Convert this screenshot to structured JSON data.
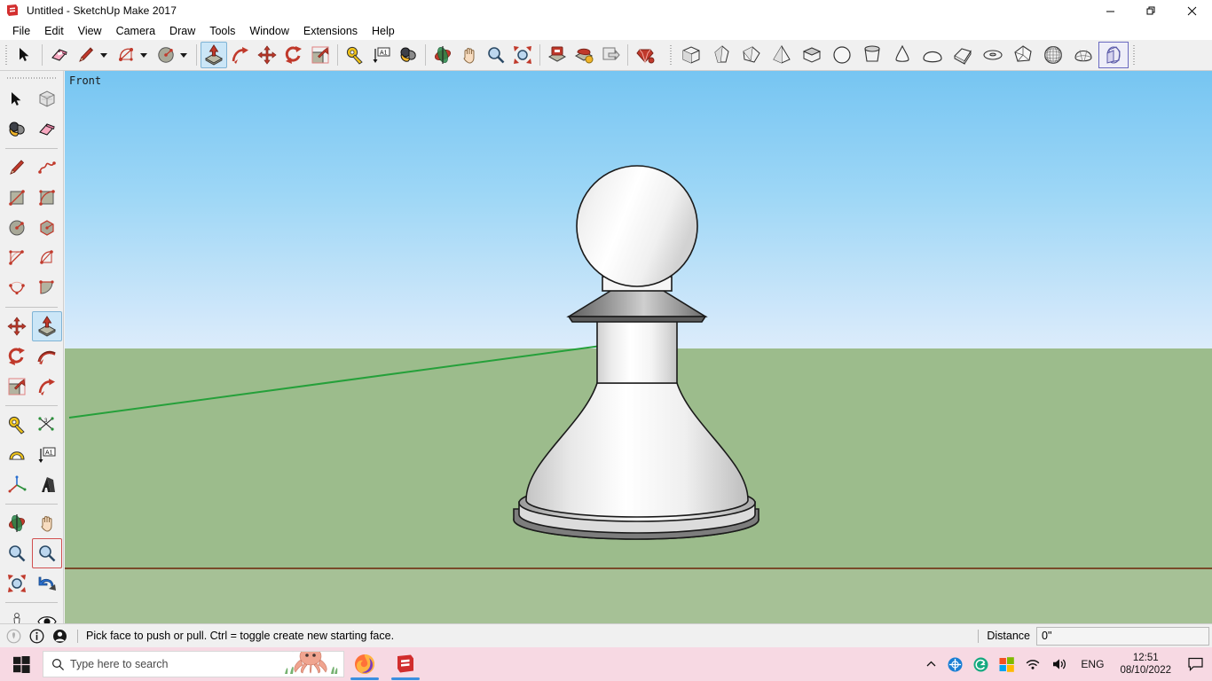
{
  "window": {
    "title": "Untitled - SketchUp Make 2017",
    "app_icon": "sketchup-logo-icon",
    "minimize": "—",
    "restore": "❐",
    "close": "✕"
  },
  "menubar": {
    "items": [
      {
        "label": "File"
      },
      {
        "label": "Edit"
      },
      {
        "label": "View"
      },
      {
        "label": "Camera"
      },
      {
        "label": "Draw"
      },
      {
        "label": "Tools"
      },
      {
        "label": "Window"
      },
      {
        "label": "Extensions"
      },
      {
        "label": "Help"
      }
    ]
  },
  "toolbar_top": {
    "groups": [
      {
        "name": "principal",
        "buttons": [
          {
            "icon": "select-arrow-icon",
            "label": "Select",
            "active": false,
            "caret": false
          }
        ]
      },
      {
        "name": "drawing",
        "buttons": [
          {
            "icon": "eraser-icon",
            "label": "Eraser",
            "active": false,
            "caret": false
          },
          {
            "icon": "line-pencil-icon",
            "label": "Line",
            "active": false,
            "caret": true
          },
          {
            "icon": "arc-icon",
            "label": "Arc",
            "active": false,
            "caret": true
          },
          {
            "icon": "circle-icon",
            "label": "Circle",
            "active": false,
            "caret": true
          }
        ]
      },
      {
        "name": "modification",
        "buttons": [
          {
            "icon": "push-pull-icon",
            "label": "Push/Pull",
            "active": true,
            "caret": false
          },
          {
            "icon": "follow-me-icon",
            "label": "Follow Me",
            "active": false,
            "caret": false
          },
          {
            "icon": "move-icon",
            "label": "Move",
            "active": false,
            "caret": false
          },
          {
            "icon": "rotate-icon",
            "label": "Rotate",
            "active": false,
            "caret": false
          },
          {
            "icon": "scale-icon",
            "label": "Scale",
            "active": false,
            "caret": false
          }
        ]
      },
      {
        "name": "construction",
        "buttons": [
          {
            "icon": "tape-measure-icon",
            "label": "Tape Measure",
            "active": false,
            "caret": false
          },
          {
            "icon": "dimension-icon",
            "label": "Dimension",
            "active": false,
            "caret": false
          },
          {
            "icon": "paint-bucket-icon",
            "label": "Paint Bucket",
            "active": false,
            "caret": false
          }
        ]
      },
      {
        "name": "camera",
        "buttons": [
          {
            "icon": "orbit-icon",
            "label": "Orbit",
            "active": false,
            "caret": false
          },
          {
            "icon": "pan-hand-icon",
            "label": "Pan",
            "active": false,
            "caret": false
          },
          {
            "icon": "zoom-icon",
            "label": "Zoom",
            "active": false,
            "caret": false
          },
          {
            "icon": "zoom-extents-icon",
            "label": "Zoom Extents",
            "active": false,
            "caret": false
          }
        ]
      },
      {
        "name": "warehouse",
        "buttons": [
          {
            "icon": "3d-warehouse-icon",
            "label": "3D Warehouse",
            "active": false,
            "caret": false
          },
          {
            "icon": "share-model-icon",
            "label": "Share Model",
            "active": false,
            "caret": false
          },
          {
            "icon": "share-component-icon",
            "label": "Share Component",
            "active": false,
            "caret": false
          }
        ]
      },
      {
        "name": "extensions",
        "buttons": [
          {
            "icon": "extension-warehouse-icon",
            "label": "Extension Warehouse",
            "active": false,
            "caret": false
          }
        ]
      }
    ],
    "shapes": [
      {
        "icon": "box-shape-icon",
        "label": "Box",
        "selected": false
      },
      {
        "icon": "prism-shape-icon",
        "label": "Prism",
        "selected": false
      },
      {
        "icon": "wedge-shape-icon",
        "label": "Wedge",
        "selected": false
      },
      {
        "icon": "pyramid-shape-icon",
        "label": "Pyramid",
        "selected": false
      },
      {
        "icon": "cylinder-shape-icon",
        "label": "Cylinder",
        "selected": false
      },
      {
        "icon": "sphere-shape-icon",
        "label": "Sphere",
        "selected": false
      },
      {
        "icon": "tube-shape-icon",
        "label": "Tube",
        "selected": false
      },
      {
        "icon": "cone-shape-icon",
        "label": "Cone",
        "selected": false
      },
      {
        "icon": "dome-shape-icon",
        "label": "Dome",
        "selected": false
      },
      {
        "icon": "slab-shape-icon",
        "label": "Slab",
        "selected": false
      },
      {
        "icon": "torus-shape-icon",
        "label": "Torus",
        "selected": false
      },
      {
        "icon": "polyhedron-shape-icon",
        "label": "Polyhedron",
        "selected": false
      },
      {
        "icon": "geodesic-shape-icon",
        "label": "Geodesic Sphere",
        "selected": false
      },
      {
        "icon": "facet-dome-shape-icon",
        "label": "Faceted Dome",
        "selected": false
      },
      {
        "icon": "shapes-overlay-icon",
        "label": "Shapes",
        "selected": true
      }
    ]
  },
  "toolbar_left": {
    "rows": [
      {
        "sep_after": false,
        "buttons": [
          {
            "icon": "select-arrow-icon",
            "label": "Select",
            "state": "normal"
          },
          {
            "icon": "make-component-icon",
            "label": "Make Component",
            "state": "normal"
          }
        ]
      },
      {
        "sep_after": true,
        "buttons": [
          {
            "icon": "paint-bucket-icon",
            "label": "Paint Bucket",
            "state": "normal"
          },
          {
            "icon": "eraser-icon",
            "label": "Eraser",
            "state": "normal"
          }
        ]
      },
      {
        "sep_after": false,
        "buttons": [
          {
            "icon": "line-pencil-icon",
            "label": "Line",
            "state": "normal"
          },
          {
            "icon": "freehand-icon",
            "label": "Freehand",
            "state": "normal"
          }
        ]
      },
      {
        "sep_after": false,
        "buttons": [
          {
            "icon": "rectangle-icon",
            "label": "Rectangle",
            "state": "normal"
          },
          {
            "icon": "rotated-rectangle-icon",
            "label": "Rotated Rectangle",
            "state": "normal"
          }
        ]
      },
      {
        "sep_after": false,
        "buttons": [
          {
            "icon": "circle-icon",
            "label": "Circle",
            "state": "normal"
          },
          {
            "icon": "polygon-icon",
            "label": "Polygon",
            "state": "normal"
          }
        ]
      },
      {
        "sep_after": false,
        "buttons": [
          {
            "icon": "arc-icon",
            "label": "Arc",
            "state": "normal"
          },
          {
            "icon": "two-point-arc-icon",
            "label": "2 Point Arc",
            "state": "normal"
          }
        ]
      },
      {
        "sep_after": true,
        "buttons": [
          {
            "icon": "three-point-arc-icon",
            "label": "3 Point Arc",
            "state": "normal"
          },
          {
            "icon": "pie-icon",
            "label": "Pie",
            "state": "normal"
          }
        ]
      },
      {
        "sep_after": false,
        "buttons": [
          {
            "icon": "move-icon",
            "label": "Move",
            "state": "normal"
          },
          {
            "icon": "push-pull-icon",
            "label": "Push/Pull",
            "state": "active"
          }
        ]
      },
      {
        "sep_after": false,
        "buttons": [
          {
            "icon": "rotate-icon",
            "label": "Rotate",
            "state": "normal"
          },
          {
            "icon": "follow-me-icon",
            "label": "Follow Me",
            "state": "normal"
          }
        ]
      },
      {
        "sep_after": true,
        "buttons": [
          {
            "icon": "scale-icon",
            "label": "Scale",
            "state": "normal"
          },
          {
            "icon": "offset-icon",
            "label": "Offset",
            "state": "normal"
          }
        ]
      },
      {
        "sep_after": false,
        "buttons": [
          {
            "icon": "tape-measure-icon",
            "label": "Tape Measure",
            "state": "normal"
          },
          {
            "icon": "dimension-icon",
            "label": "Dimensions",
            "state": "normal"
          }
        ]
      },
      {
        "sep_after": false,
        "buttons": [
          {
            "icon": "protractor-icon",
            "label": "Protractor",
            "state": "normal"
          },
          {
            "icon": "text-icon",
            "label": "Text",
            "state": "normal"
          }
        ]
      },
      {
        "sep_after": true,
        "buttons": [
          {
            "icon": "axes-icon",
            "label": "Axes",
            "state": "normal"
          },
          {
            "icon": "3d-text-icon",
            "label": "3D Text",
            "state": "normal"
          }
        ]
      },
      {
        "sep_after": false,
        "buttons": [
          {
            "icon": "orbit-icon",
            "label": "Orbit",
            "state": "normal"
          },
          {
            "icon": "pan-hand-icon",
            "label": "Pan",
            "state": "normal"
          }
        ]
      },
      {
        "sep_after": false,
        "buttons": [
          {
            "icon": "zoom-icon",
            "label": "Zoom",
            "state": "normal"
          },
          {
            "icon": "zoom-window-icon",
            "label": "Zoom Window",
            "state": "boxed"
          }
        ]
      },
      {
        "sep_after": true,
        "buttons": [
          {
            "icon": "zoom-extents-icon",
            "label": "Zoom Extents",
            "state": "normal"
          },
          {
            "icon": "previous-view-icon",
            "label": "Previous",
            "state": "normal"
          }
        ]
      },
      {
        "sep_after": false,
        "buttons": [
          {
            "icon": "position-camera-icon",
            "label": "Position Camera",
            "state": "normal"
          },
          {
            "icon": "look-around-icon",
            "label": "Look Around",
            "state": "normal"
          }
        ]
      }
    ]
  },
  "viewport": {
    "view_label": "Front",
    "model_name": "chess-pawn-model",
    "colors": {
      "sky_top": "#76c5f2",
      "sky_bottom": "#dcecfb",
      "ground_upper": "#9cbc8c",
      "ground_lower": "#a6c196",
      "axis_green": "#25a03a",
      "axis_red": "#7a4a2a",
      "model_face": "#ffffff",
      "model_edge": "#1a1a1a"
    }
  },
  "statusbar": {
    "icons": [
      {
        "name": "geo-location-icon",
        "state": "disabled"
      },
      {
        "name": "info-circle-icon",
        "state": "normal"
      },
      {
        "name": "user-account-icon",
        "state": "normal"
      }
    ],
    "message": "Pick face to push or pull.  Ctrl = toggle create new starting face.",
    "measurement_label": "Distance",
    "measurement_value": "0\""
  },
  "taskbar": {
    "start_icon": "windows-start-icon",
    "search": {
      "icon": "search-icon",
      "placeholder": "Type here to search",
      "value": ""
    },
    "apps": [
      {
        "icon": "firefox-icon",
        "label": "Mozilla Firefox",
        "running": true
      },
      {
        "icon": "sketchup-icon",
        "label": "SketchUp Make 2017",
        "running": true
      }
    ],
    "tray": [
      {
        "icon": "show-hidden-icons-chevron-icon",
        "label": "Show hidden icons"
      },
      {
        "icon": "onedrive-like-blue-icon",
        "label": "Tray app"
      },
      {
        "icon": "grammarly-icon",
        "label": "Tray app"
      },
      {
        "icon": "windows-colored-icon",
        "label": "Tray app"
      },
      {
        "icon": "wifi-icon",
        "label": "Network"
      },
      {
        "icon": "volume-icon",
        "label": "Volume"
      }
    ],
    "language": "ENG",
    "clock_time": "12:51",
    "clock_date": "08/10/2022",
    "notification_icon": "action-center-icon"
  }
}
